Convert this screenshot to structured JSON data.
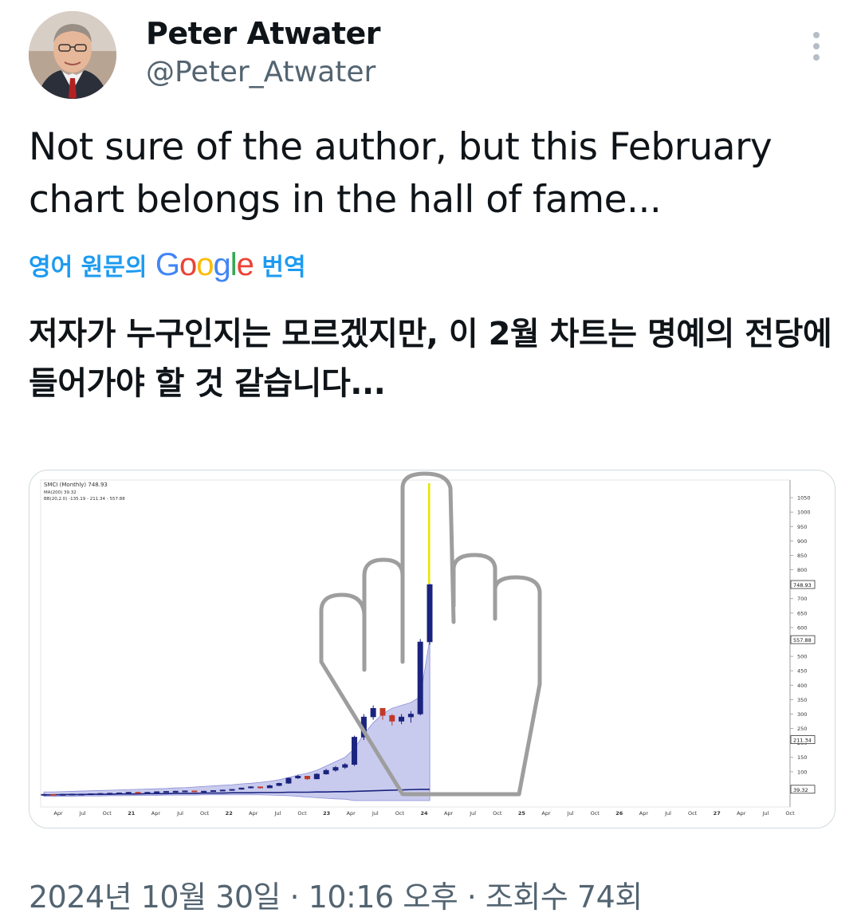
{
  "author": {
    "name": "Peter Atwater",
    "handle": "@Peter_Atwater"
  },
  "tweet": {
    "text": "Not sure of the author, but this February chart belongs in the hall of fame...",
    "translate_prefix": "영어 원문의",
    "translate_suffix": "번역",
    "translated_text": "저자가 누구인지는 모르겠지만, 이 2월 차트는 명예의 전당에 들어가야 할 것 같습니다..."
  },
  "meta": {
    "timestamp": "2024년 10월 30일 · 10:16 오후 · 조회수 74회"
  },
  "icons": {
    "more": "more-vertical-icon",
    "google_logo": "google-wordmark"
  },
  "colors": {
    "link_blue": "#1d9bf0",
    "secondary_text": "#536471",
    "candle_up": "#1a237e",
    "candle_down": "#c0392b",
    "band_fill": "#b7b9e8",
    "spike_highlight": "#e6e600",
    "hand_outline": "#9e9e9e"
  },
  "chart_legend": {
    "line1": "SMCI (Monthly) 748.93",
    "line2": "MA(200) 39.32",
    "line3": "BB(20,2.0) -135.19 - 211.34 - 557.88"
  },
  "chart_data": {
    "type": "candlestick",
    "y_ticks": [
      100,
      150,
      200,
      250,
      300,
      350,
      400,
      450,
      500,
      550,
      600,
      650,
      700,
      750,
      800,
      850,
      900,
      950,
      1000,
      1050
    ],
    "y_badges": [
      "748.93",
      "557.88",
      "211.34",
      "39.32"
    ],
    "x_ticks": [
      "Apr",
      "Jul",
      "Oct",
      "21",
      "Apr",
      "Jul",
      "Oct",
      "22",
      "Apr",
      "Jul",
      "Oct",
      "23",
      "Apr",
      "Jul",
      "Oct",
      "24",
      "Apr",
      "Jul",
      "Oct",
      "25",
      "Apr",
      "Jul",
      "Oct",
      "26",
      "Apr",
      "Jul",
      "Oct",
      "27",
      "Apr",
      "Jul",
      "Oct"
    ],
    "ylim": [
      0,
      1100
    ],
    "candles": [
      [
        22,
        23,
        21,
        22
      ],
      [
        22,
        22,
        20,
        21
      ],
      [
        21,
        23,
        20,
        22
      ],
      [
        22,
        24,
        21,
        23
      ],
      [
        23,
        24,
        22,
        23
      ],
      [
        23,
        25,
        22,
        24
      ],
      [
        24,
        26,
        23,
        25
      ],
      [
        25,
        27,
        24,
        26
      ],
      [
        26,
        28,
        25,
        27
      ],
      [
        27,
        30,
        26,
        29
      ],
      [
        29,
        31,
        27,
        28
      ],
      [
        28,
        30,
        27,
        29
      ],
      [
        29,
        32,
        28,
        31
      ],
      [
        31,
        33,
        30,
        32
      ],
      [
        32,
        34,
        31,
        33
      ],
      [
        33,
        35,
        32,
        34
      ],
      [
        34,
        33,
        30,
        31
      ],
      [
        31,
        34,
        30,
        33
      ],
      [
        33,
        36,
        32,
        35
      ],
      [
        35,
        38,
        34,
        37
      ],
      [
        37,
        40,
        36,
        39
      ],
      [
        39,
        45,
        38,
        44
      ],
      [
        44,
        50,
        42,
        48
      ],
      [
        48,
        47,
        42,
        44
      ],
      [
        44,
        55,
        43,
        52
      ],
      [
        52,
        62,
        50,
        60
      ],
      [
        60,
        80,
        58,
        78
      ],
      [
        78,
        90,
        75,
        85
      ],
      [
        85,
        80,
        72,
        75
      ],
      [
        75,
        95,
        74,
        92
      ],
      [
        92,
        110,
        90,
        105
      ],
      [
        105,
        120,
        100,
        115
      ],
      [
        115,
        130,
        110,
        125
      ],
      [
        125,
        225,
        120,
        220
      ],
      [
        220,
        300,
        210,
        290
      ],
      [
        290,
        330,
        280,
        320
      ],
      [
        320,
        310,
        280,
        295
      ],
      [
        295,
        300,
        260,
        275
      ],
      [
        275,
        300,
        265,
        290
      ],
      [
        290,
        310,
        270,
        300
      ],
      [
        300,
        560,
        295,
        550
      ],
      [
        550,
        1050,
        540,
        749
      ]
    ],
    "ma200": [
      20,
      20,
      21,
      21,
      21,
      22,
      22,
      22,
      23,
      23,
      23,
      24,
      24,
      24,
      25,
      25,
      25,
      26,
      26,
      26,
      27,
      27,
      27,
      28,
      28,
      28,
      29,
      29,
      29,
      30,
      30,
      31,
      31,
      32,
      33,
      34,
      35,
      36,
      37,
      38,
      39,
      39
    ],
    "bb_upper": [
      30,
      30,
      31,
      32,
      33,
      34,
      35,
      36,
      37,
      38,
      39,
      40,
      41,
      42,
      44,
      45,
      47,
      49,
      51,
      53,
      55,
      58,
      60,
      63,
      67,
      72,
      80,
      88,
      95,
      105,
      120,
      135,
      150,
      180,
      230,
      270,
      300,
      320,
      330,
      340,
      360,
      558
    ],
    "bb_lower": [
      15,
      15,
      15,
      15,
      16,
      16,
      16,
      17,
      17,
      17,
      18,
      18,
      18,
      19,
      19,
      19,
      19,
      20,
      20,
      20,
      20,
      20,
      20,
      20,
      19,
      18,
      17,
      15,
      12,
      10,
      8,
      6,
      5,
      0,
      0,
      0,
      0,
      0,
      0,
      0,
      0,
      0
    ]
  }
}
